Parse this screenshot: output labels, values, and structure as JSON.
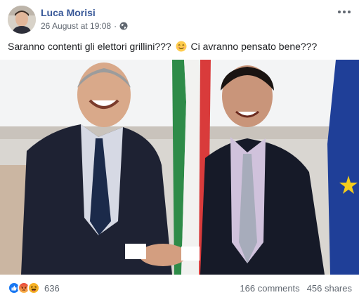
{
  "post": {
    "author": "Luca Morisi",
    "timestamp": "26 August at 19:08",
    "separator": "·",
    "privacy_icon": "globe-icon",
    "menu_icon": "more-options-icon",
    "text_part1": "Saranno contenti gli elettori grillini???",
    "text_emoji": "smiling-face-emoji",
    "text_part2": "Ci avranno pensato bene???"
  },
  "reactions": {
    "types": [
      "like",
      "angry",
      "haha"
    ],
    "count": "636"
  },
  "stats": {
    "comments": "166 comments",
    "shares": "456 shares"
  },
  "colors": {
    "link": "#385898",
    "secondary_text": "#606770",
    "like_blue": "#1877f2",
    "angry_orange": "#f0663a",
    "haha_yellow": "#f7b125"
  }
}
